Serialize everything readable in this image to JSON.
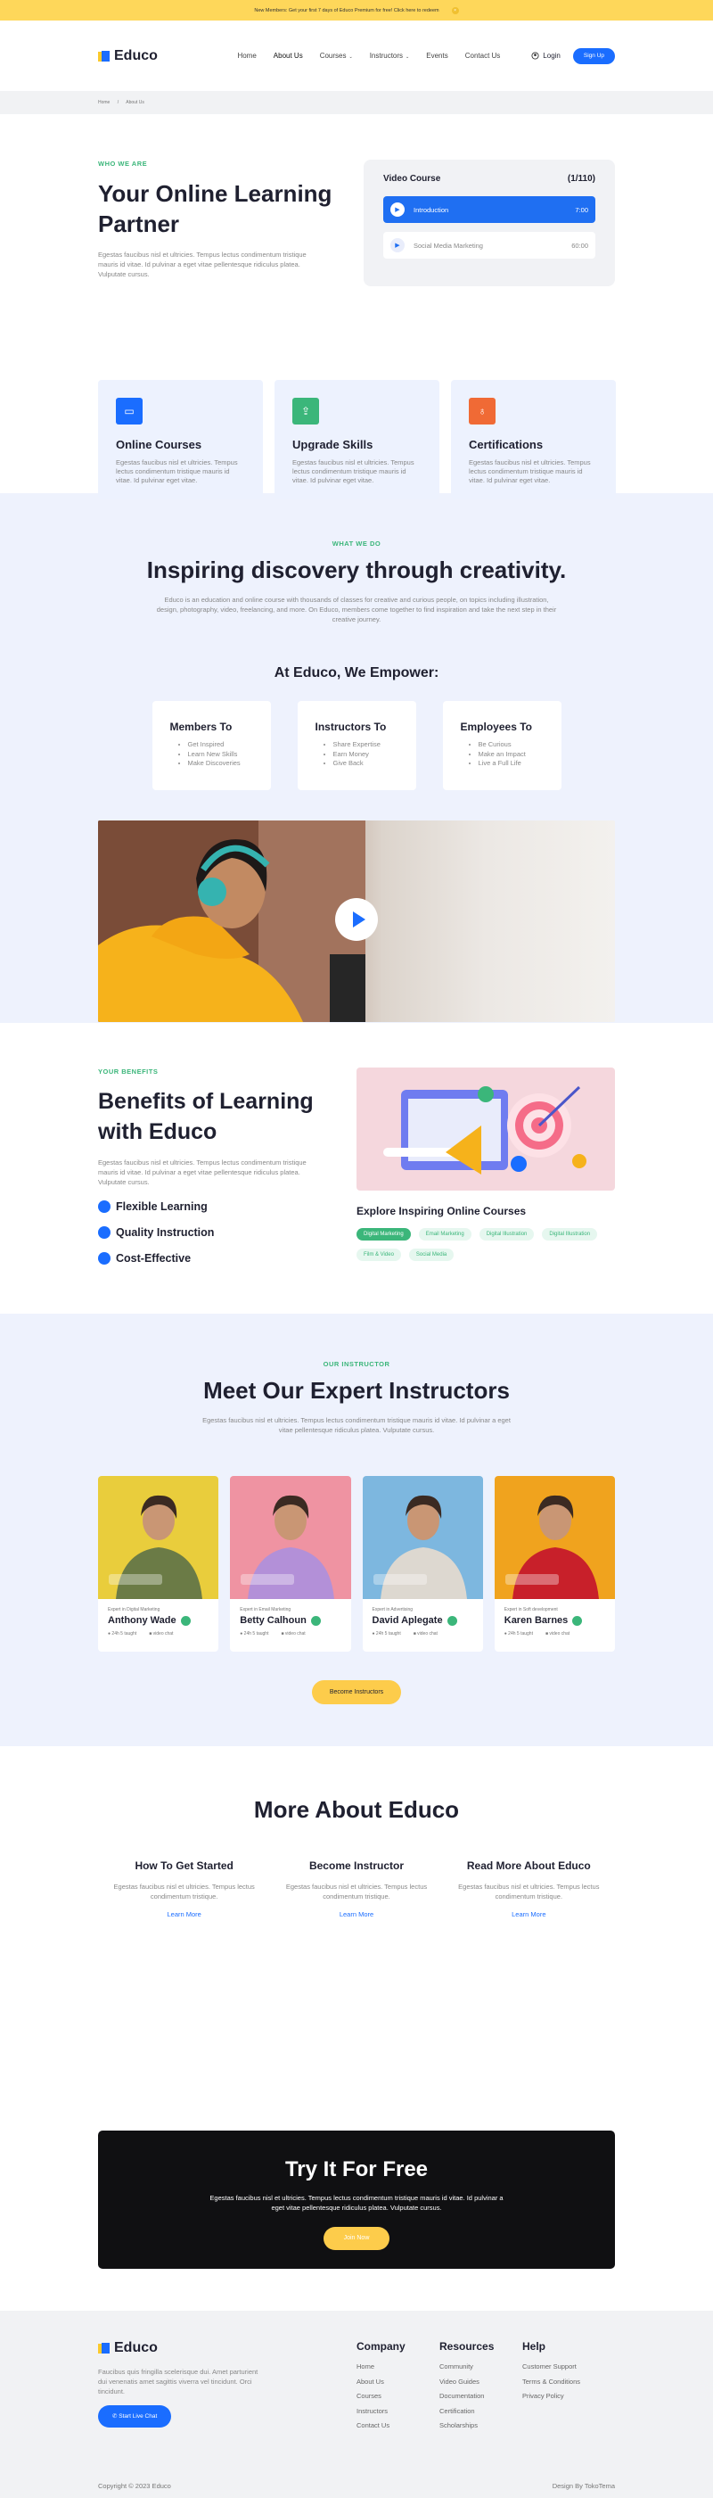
{
  "topbar": {
    "text": "New Members: Get your first 7 days of Educo Premium for free! Click here to redeem",
    "close": "×"
  },
  "brand": {
    "name": "Educo"
  },
  "nav": {
    "items": [
      {
        "label": "Home",
        "caret": ""
      },
      {
        "label": "About Us",
        "caret": ""
      },
      {
        "label": "Courses",
        "caret": "⌄"
      },
      {
        "label": "Instructors",
        "caret": "⌄"
      },
      {
        "label": "Events",
        "caret": ""
      },
      {
        "label": "Contact Us",
        "caret": ""
      }
    ],
    "active": "About Us",
    "login": "Login",
    "signup": "Sign Up"
  },
  "breadcrumb": {
    "home": "Home",
    "sep": "/",
    "current": "About Us"
  },
  "hero": {
    "eyebrow": "WHO WE ARE",
    "title": "Your Online Learning Partner",
    "text": "Egestas faucibus nisl et ultricies. Tempus lectus condimentum tristique mauris id vitae. Id pulvinar a eget vitae pellentesque ridiculus platea. Vulputate cursus.",
    "video": {
      "title": "Video Course",
      "count": "(1/110)",
      "rows": [
        {
          "label": "Introduction",
          "time": "7:00"
        },
        {
          "label": "Social Media Marketing",
          "time": "60:00"
        }
      ]
    },
    "features": [
      {
        "title": "Online Courses",
        "text": "Egestas faucibus nisl et ultricies. Tempus lectus condimentum tristique mauris id vitae. Id pulvinar eget vitae.",
        "color": "#1a6dff",
        "icon": "book-icon"
      },
      {
        "title": "Upgrade Skills",
        "text": "Egestas faucibus nisl et ultricies. Tempus lectus condimentum tristique mauris id vitae. Id pulvinar eget vitae.",
        "color": "#3bb67a",
        "icon": "upload-icon"
      },
      {
        "title": "Certifications",
        "text": "Egestas faucibus nisl et ultricies. Tempus lectus condimentum tristique mauris id vitae. Id pulvinar eget vitae.",
        "color": "#f06a35",
        "icon": "award-icon"
      }
    ]
  },
  "whatwedo": {
    "eyebrow": "WHAT WE DO",
    "title": "Inspiring discovery through creativity.",
    "text": "Educo is an education and online course with thousands of classes for creative and curious people, on topics including illustration, design, photography, video, freelancing, and more. On Educo, members come together to find inspiration and take the next step in their creative journey.",
    "empower": "At Educo, We Empower:",
    "cards": [
      {
        "title": "Members To",
        "items": [
          "Get Inspired",
          "Learn New Skills",
          "Make Discoveries"
        ]
      },
      {
        "title": "Instructors To",
        "items": [
          "Share Expertise",
          "Earn Money",
          "Give Back"
        ]
      },
      {
        "title": "Employees To",
        "items": [
          "Be Curious",
          "Make an Impact",
          "Live a Full Life"
        ]
      }
    ]
  },
  "benefits": {
    "eyebrow": "YOUR BENEFITS",
    "title": "Benefits of Learning with Educo",
    "text": "Egestas faucibus nisl et ultricies. Tempus lectus condimentum tristique mauris id vitae. Id pulvinar a eget vitae pellentesque ridiculus platea. Vulputate cursus.",
    "items": [
      "Flexible Learning",
      "Quality Instruction",
      "Cost-Effective"
    ],
    "explore": "Explore Inspiring Online Courses",
    "tags": [
      "Digital Marketing",
      "Email Marketing",
      "Digital Illustration",
      "Digital Illustration",
      "Film & Video",
      "Social Media"
    ]
  },
  "instructors": {
    "eyebrow": "OUR INSTRUCTOR",
    "title": "Meet Our Expert Instructors",
    "text": "Egestas faucibus nisl et ultricies. Tempus lectus condimentum tristique mauris id vitae. Id pulvinar a eget vitae pellentesque ridiculus platea. Vulputate cursus.",
    "people": [
      {
        "role": "Expert in Digital Marketing",
        "name": "Anthony Wade",
        "hours": "24h 5 taught",
        "chat": "video chat",
        "bg": "#e9cd3c",
        "shirt": "#6b7b46"
      },
      {
        "role": "Expert in Email Marketing",
        "name": "Betty Calhoun",
        "hours": "24h 5 taught",
        "chat": "video chat",
        "bg": "#ef93a2",
        "shirt": "#b390d8"
      },
      {
        "role": "Expert in Advertising",
        "name": "David Aplegate",
        "hours": "24h 5 taught",
        "chat": "video chat",
        "bg": "#7db7df",
        "shirt": "#ddd8d0"
      },
      {
        "role": "Expert in Soft development",
        "name": "Karen Barnes",
        "hours": "24h 5 taught",
        "chat": "video chat",
        "bg": "#f0a31e",
        "shirt": "#c8202a"
      }
    ],
    "button": "Become Instructors"
  },
  "more": {
    "title": "More About Educo",
    "cols": [
      {
        "title": "How To Get Started",
        "text": "Egestas faucibus nisl et ultricies. Tempus lectus condimentum tristique.",
        "link": "Learn More"
      },
      {
        "title": "Become Instructor",
        "text": "Egestas faucibus nisl et ultricies. Tempus lectus condimentum tristique.",
        "link": "Learn More"
      },
      {
        "title": "Read More About Educo",
        "text": "Egestas faucibus nisl et ultricies. Tempus lectus condimentum tristique.",
        "link": "Learn More"
      }
    ]
  },
  "try": {
    "title": "Try It For Free",
    "text": "Egestas faucibus nisl et ultricies. Tempus lectus condimentum tristique mauris id vitae. Id pulvinar a eget vitae pellentesque ridiculus platea. Vulputate cursus.",
    "button": "Join Now"
  },
  "footer": {
    "text": "Faucibus quis fringilla scelerisque dui. Amet parturient dui venenatis amet sagittis viverra vel tincidunt. Orci tincidunt.",
    "chat": "Start Live Chat",
    "company": {
      "title": "Company",
      "links": [
        "Home",
        "About Us",
        "Courses",
        "Instructors",
        "Contact Us"
      ]
    },
    "resources": {
      "title": "Resources",
      "links": [
        "Community",
        "Video Guides",
        "Documentation",
        "Certification",
        "Scholarships"
      ]
    },
    "help": {
      "title": "Help",
      "links": [
        "Customer Support",
        "Terms & Conditions",
        "Privacy Policy"
      ]
    },
    "copyright": "Copyright © 2023 Educo",
    "credit": "Design By TokoTema"
  }
}
